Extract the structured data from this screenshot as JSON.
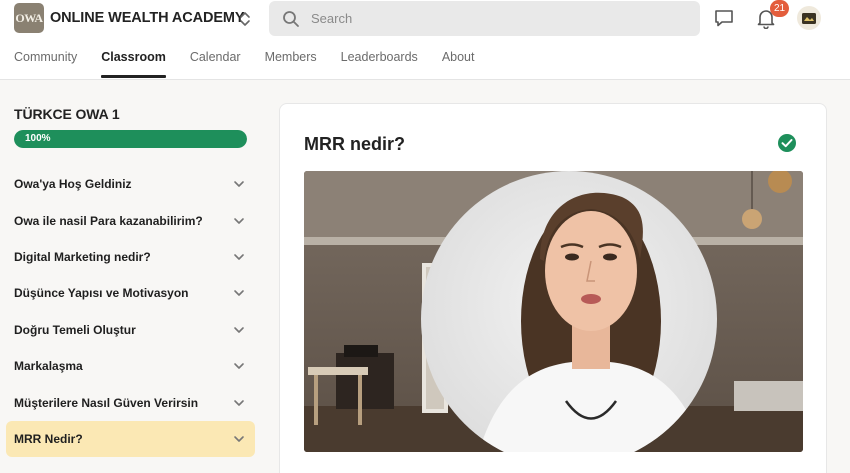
{
  "header": {
    "logo_text": "OWA",
    "app_title": "ONLINE WEALTH ACADEMY",
    "switcher_icon": "chevron-updown-icon",
    "search": {
      "placeholder": "Search",
      "value": ""
    },
    "notification_count": "21"
  },
  "tabs": [
    {
      "label": "Community",
      "active": false
    },
    {
      "label": "Classroom",
      "active": true
    },
    {
      "label": "Calendar",
      "active": false
    },
    {
      "label": "Members",
      "active": false
    },
    {
      "label": "Leaderboards",
      "active": false
    },
    {
      "label": "About",
      "active": false
    }
  ],
  "course": {
    "title": "TÜRKCE OWA 1",
    "progress_label": "100%",
    "progress_value": 1.0,
    "modules": [
      {
        "label": "Owa'ya Hoş Geldiniz"
      },
      {
        "label": "Owa ile nasil Para kazanabilirim?"
      },
      {
        "label": "Digital Marketing nedir?"
      },
      {
        "label": "Düşünce Yapısı ve Motivasyon"
      },
      {
        "label": "Doğru Temeli Oluştur"
      },
      {
        "label": "Markalaşma"
      },
      {
        "label": "Müşterilere Nasıl Güven Verirsin"
      },
      {
        "label": "MRR Nedir?"
      }
    ],
    "active_module_index": 7
  },
  "lesson": {
    "title": "MRR nedir?",
    "completed": true
  },
  "colors": {
    "accent_green": "#1e8f5b",
    "badge_red": "#e35d3c",
    "active_module_bg": "#fbe8b4"
  }
}
